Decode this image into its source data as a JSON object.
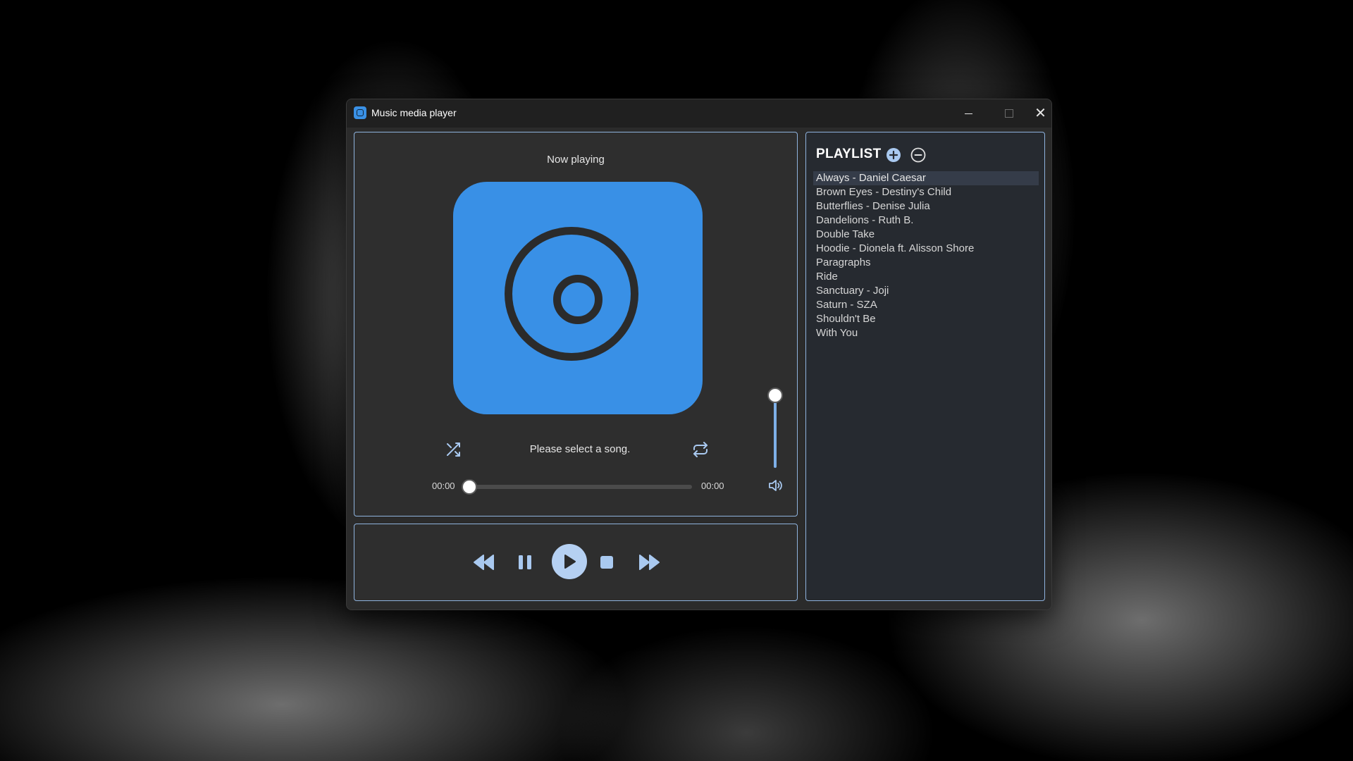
{
  "window": {
    "title": "Music media player"
  },
  "now_playing": {
    "label": "Now playing",
    "status": "Please select a song.",
    "current_time": "00:00",
    "total_time": "00:00",
    "progress": 0.0,
    "volume": 1.0,
    "art_icon": "disc-icon"
  },
  "controls": {
    "shuffle_icon": "shuffle-icon",
    "repeat_icon": "repeat-icon",
    "volume_icon": "speaker-icon",
    "rewind_icon": "rewind-icon",
    "pause_icon": "pause-icon",
    "play_icon": "play-icon",
    "stop_icon": "stop-icon",
    "fast_forward_icon": "fast-forward-icon"
  },
  "playlist": {
    "title": "PLAYLIST",
    "add_icon": "plus-circle-icon",
    "remove_icon": "minus-circle-icon",
    "selected_index": 0,
    "items": [
      "Always - Daniel Caesar",
      "Brown Eyes - Destiny's Child",
      "Butterflies - Denise Julia",
      "Dandelions - Ruth B.",
      "Double Take",
      "Hoodie - Dionela ft. Alisson Shore",
      "Paragraphs",
      "Ride",
      "Sanctuary - Joji",
      "Saturn - SZA",
      "Shouldn't Be",
      "With You"
    ]
  },
  "colors": {
    "accent": "#3990e6",
    "accent_light": "#b5d0f2",
    "panel_border": "#8fb3de",
    "background": "#2b2b2b"
  }
}
